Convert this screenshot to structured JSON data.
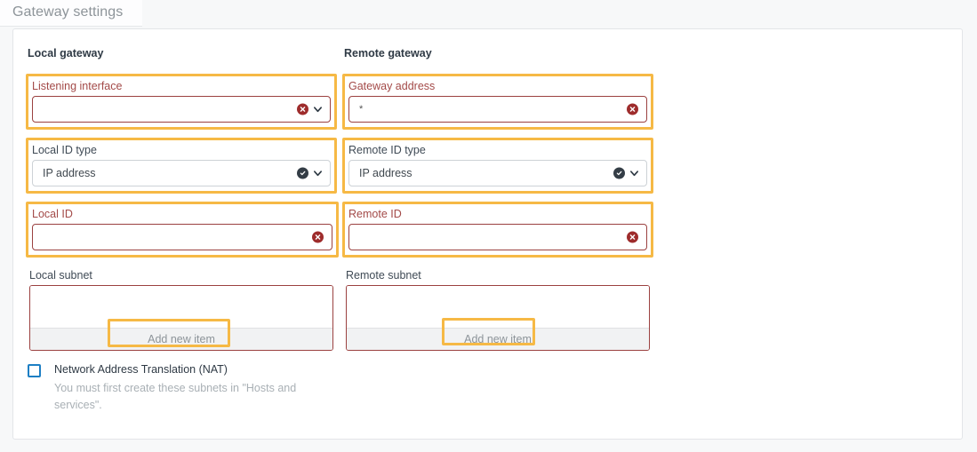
{
  "header": {
    "title": "Gateway settings"
  },
  "columns": {
    "local": {
      "title": "Local gateway",
      "fields": {
        "listening_interface": {
          "label": "Listening interface",
          "value": "",
          "state": "error",
          "icon": "error-circle-icon",
          "chevron": "chevron-down-icon"
        },
        "local_id_type": {
          "label": "Local ID type",
          "value": "IP address",
          "state": "valid",
          "icon": "check-circle-icon",
          "chevron": "chevron-down-icon"
        },
        "local_id": {
          "label": "Local ID",
          "value": "",
          "state": "error",
          "icon": "error-circle-icon"
        },
        "local_subnet": {
          "label": "Local subnet",
          "state": "error",
          "add_label": "Add new item"
        }
      }
    },
    "remote": {
      "title": "Remote gateway",
      "fields": {
        "gateway_address": {
          "label": "Gateway address",
          "value": "*",
          "state": "error",
          "icon": "error-circle-icon"
        },
        "remote_id_type": {
          "label": "Remote ID type",
          "value": "IP address",
          "state": "valid",
          "icon": "check-circle-icon",
          "chevron": "chevron-down-icon"
        },
        "remote_id": {
          "label": "Remote ID",
          "value": "",
          "state": "error",
          "icon": "error-circle-icon"
        },
        "remote_subnet": {
          "label": "Remote subnet",
          "state": "error",
          "add_label": "Add new item"
        }
      }
    }
  },
  "nat": {
    "label": "Network Address Translation (NAT)",
    "help": "You must first create these subnets in \"Hosts and services\".",
    "checked": false
  },
  "colors": {
    "highlight": "#f6b945",
    "error_border": "#9b4140",
    "error_label": "#a34a48",
    "error_icon": "#9e2c2c",
    "valid_icon": "#343d46",
    "checkbox_border": "#1d7fc4",
    "card_border": "#e3e5e8",
    "page_background": "#f7f8f9"
  }
}
